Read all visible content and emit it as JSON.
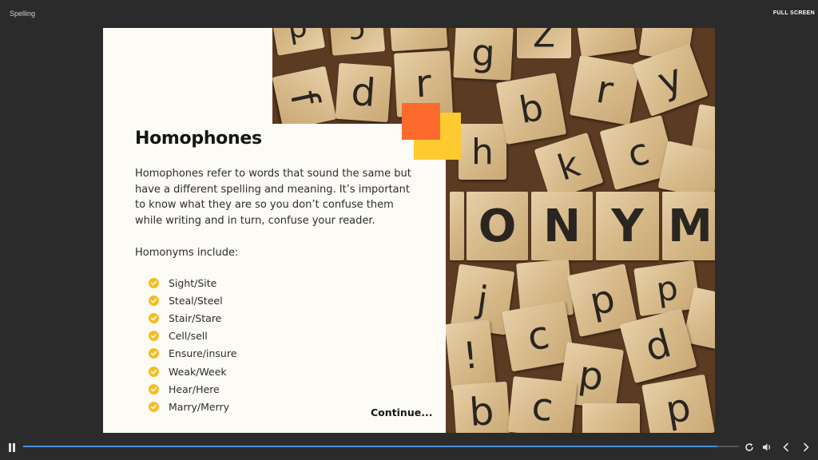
{
  "course": {
    "title": "Spelling",
    "fullscreen_label": "FULL SCREEN"
  },
  "slide": {
    "heading": "Homophones",
    "body": "Homophones refer to words that sound the same but have a different spelling and meaning. It’s important to know what they are so you don’t confuse them while writing and in turn, confuse your reader.",
    "list_intro": "Homonyms include:",
    "items": [
      "Sight/Site",
      "Steal/Steel",
      "Stair/Stare",
      "Cell/sell",
      "Ensure/insure",
      "Weak/Week",
      "Hear/Here",
      "Marry/Merry"
    ],
    "continue_label": "Continue...",
    "photo_letters": "ONYM",
    "accent_colors": {
      "orange": "#fc6a2e",
      "yellow": "#fdca2f",
      "check": "#f7bd20"
    }
  },
  "player": {
    "progress": 0.97,
    "progress_color": "#4a8fd9",
    "icons": [
      "pause-icon",
      "replay-icon",
      "volume-icon",
      "previous-icon",
      "next-icon"
    ]
  }
}
